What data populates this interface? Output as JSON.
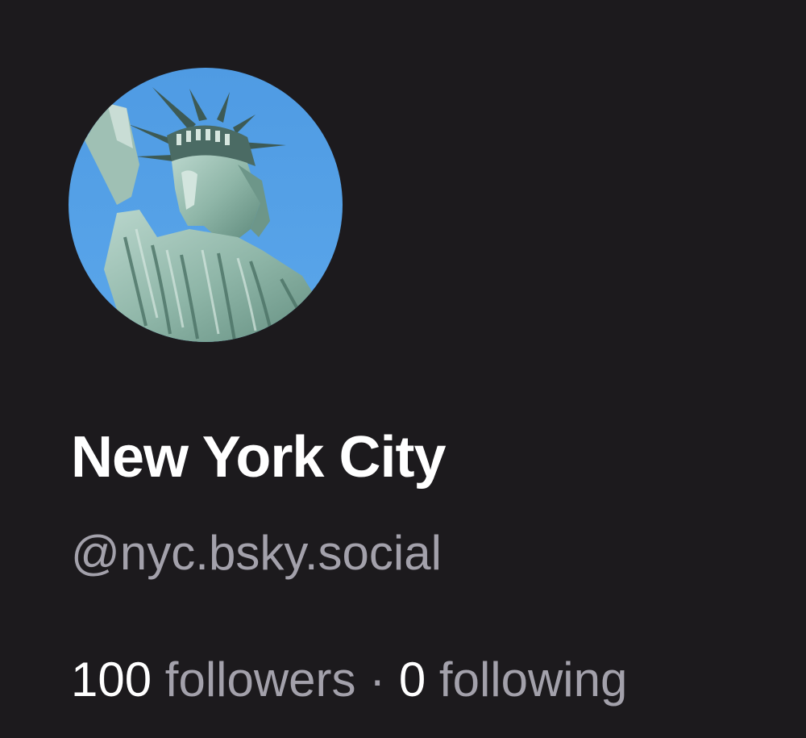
{
  "profile": {
    "avatar_icon": "statue-of-liberty-avatar",
    "display_name": "New York City",
    "handle": "@nyc.bsky.social",
    "followers_count": "100",
    "followers_label": "followers",
    "separator": "·",
    "following_count": "0",
    "following_label": "following"
  },
  "colors": {
    "background": "#1c1a1d",
    "name_text": "#ffffff",
    "muted_text": "#a3a1ab",
    "avatar_sky": "#4f9be3"
  }
}
